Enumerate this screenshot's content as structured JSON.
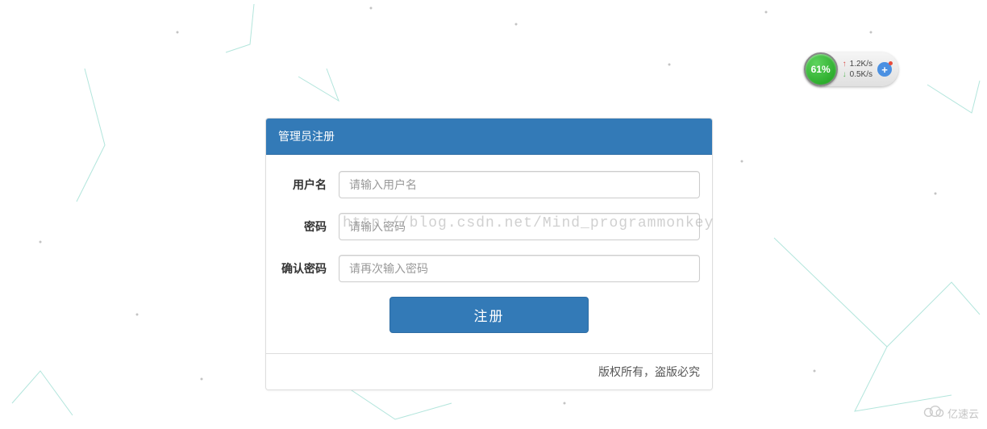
{
  "panel": {
    "title": "管理员注册",
    "footer": "版权所有，盗版必究"
  },
  "form": {
    "username": {
      "label": "用户名",
      "placeholder": "请输入用户名",
      "value": ""
    },
    "password": {
      "label": "密码",
      "placeholder": "请输入密码",
      "value": ""
    },
    "confirm_password": {
      "label": "确认密码",
      "placeholder": "请再次输入密码",
      "value": ""
    },
    "submit_label": "注册"
  },
  "watermark": {
    "text": "http://blog.csdn.net/Mind_programmonkey",
    "logo_text": "亿速云"
  },
  "speed_widget": {
    "percent": "61%",
    "upload": "1.2K/s",
    "download": "0.5K/s"
  }
}
